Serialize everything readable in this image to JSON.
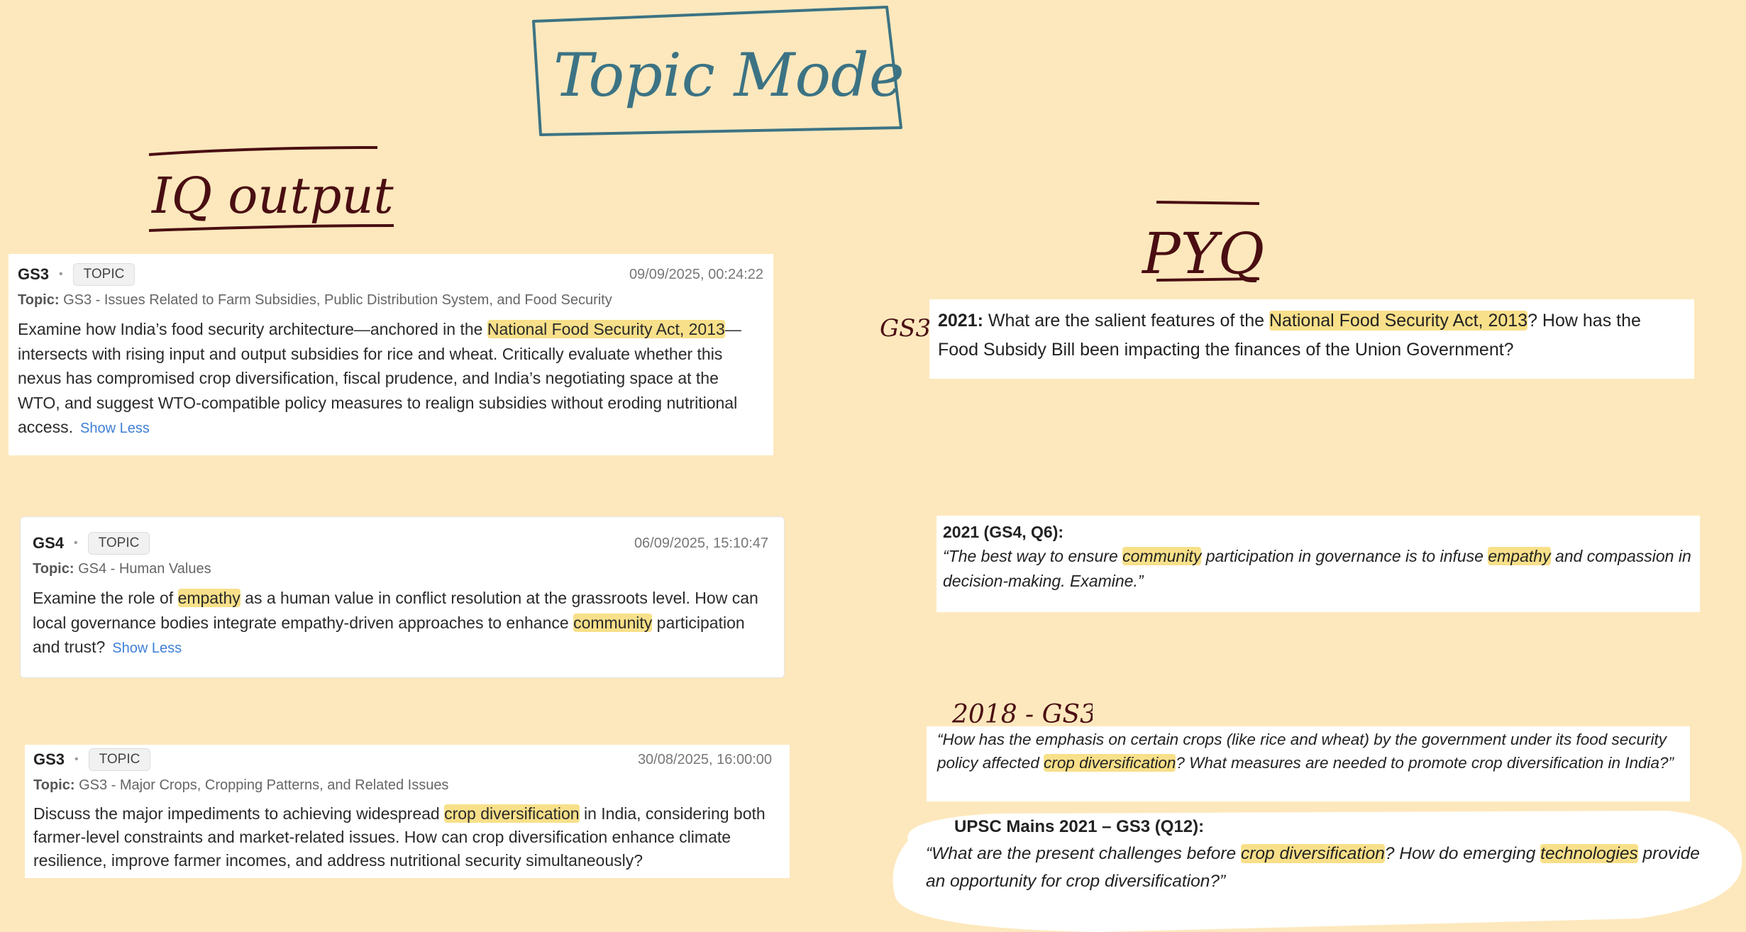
{
  "annotations": {
    "title": "Topic Mode",
    "iq_heading": "IQ output",
    "pyq_heading": "PYQ",
    "gs3_note": "GS3",
    "gs3_2018_note": "2018 - GS3"
  },
  "iq_cards": [
    {
      "code": "GS3",
      "tag": "TOPIC",
      "timestamp": "09/09/2025, 00:24:22",
      "topic_label": "Topic:",
      "topic": "GS3 - Issues Related to Farm Subsidies, Public Distribution System, and Food Security",
      "q_pre": "Examine how India’s food security architecture—anchored in the ",
      "q_hl1": "National Food Security Act, 2013",
      "q_post": "—intersects with rising input and output subsidies for rice and wheat. Critically evaluate whether this nexus has compromised crop diversification, fiscal prudence, and India’s negotiating space at the WTO, and suggest WTO-compatible policy measures to realign subsidies without eroding nutritional access.",
      "show_less": "Show Less"
    },
    {
      "code": "GS4",
      "tag": "TOPIC",
      "timestamp": "06/09/2025, 15:10:47",
      "topic_label": "Topic:",
      "topic": "GS4 - Human Values",
      "q_pre": "Examine the role of ",
      "q_hl1": "empathy",
      "q_mid": " as a human value in conflict resolution at the grassroots level. How can local governance bodies integrate empathy-driven approaches to enhance ",
      "q_hl2": "community",
      "q_post": " participation and trust?",
      "show_less": "Show Less"
    },
    {
      "code": "GS3",
      "tag": "TOPIC",
      "timestamp": "30/08/2025, 16:00:00",
      "topic_label": "Topic:",
      "topic": "GS3 - Major Crops, Cropping Patterns, and Related Issues",
      "q_pre": "Discuss the major impediments to achieving widespread ",
      "q_hl1": "crop diversification",
      "q_post": " in India, considering both farmer-level constraints and market-related issues. How can crop diversification enhance climate resilience, improve farmer incomes, and address nutritional security simultaneously?"
    }
  ],
  "pyq_cards": [
    {
      "year": "2021:",
      "q_pre": " What are the salient features of the ",
      "q_hl1": "National Food Security Act, 2013",
      "q_post": "? How has the Food Subsidy Bill been impacting the finances of the Union Government?"
    },
    {
      "header": "2021 (GS4, Q6):",
      "q_pre": "“The best way to ensure ",
      "q_hl1": "community",
      "q_mid": " participation in governance is to infuse ",
      "q_hl2": "empathy",
      "q_post": " and compassion in decision-making. Examine.”"
    },
    {
      "q_pre": "“How has the emphasis on certain crops (like rice and wheat) by the government under its food security policy affected ",
      "q_hl1": "crop diversification",
      "q_post": "? What measures are needed to promote crop diversification in India?”"
    },
    {
      "header": "UPSC Mains 2021 – GS3 (Q12):",
      "q_pre": "“What are the present challenges before ",
      "q_hl1": "crop diversification",
      "q_mid": "? How do emerging ",
      "q_hl2": "technologies",
      "q_post": " provide an opportunity for crop diversification?”"
    }
  ],
  "colors": {
    "background": "#fde8bd",
    "highlight": "#f8e08a",
    "link": "#3f7fd6",
    "title_ink": "#3c7384",
    "heading_ink": "#4a0e12"
  }
}
